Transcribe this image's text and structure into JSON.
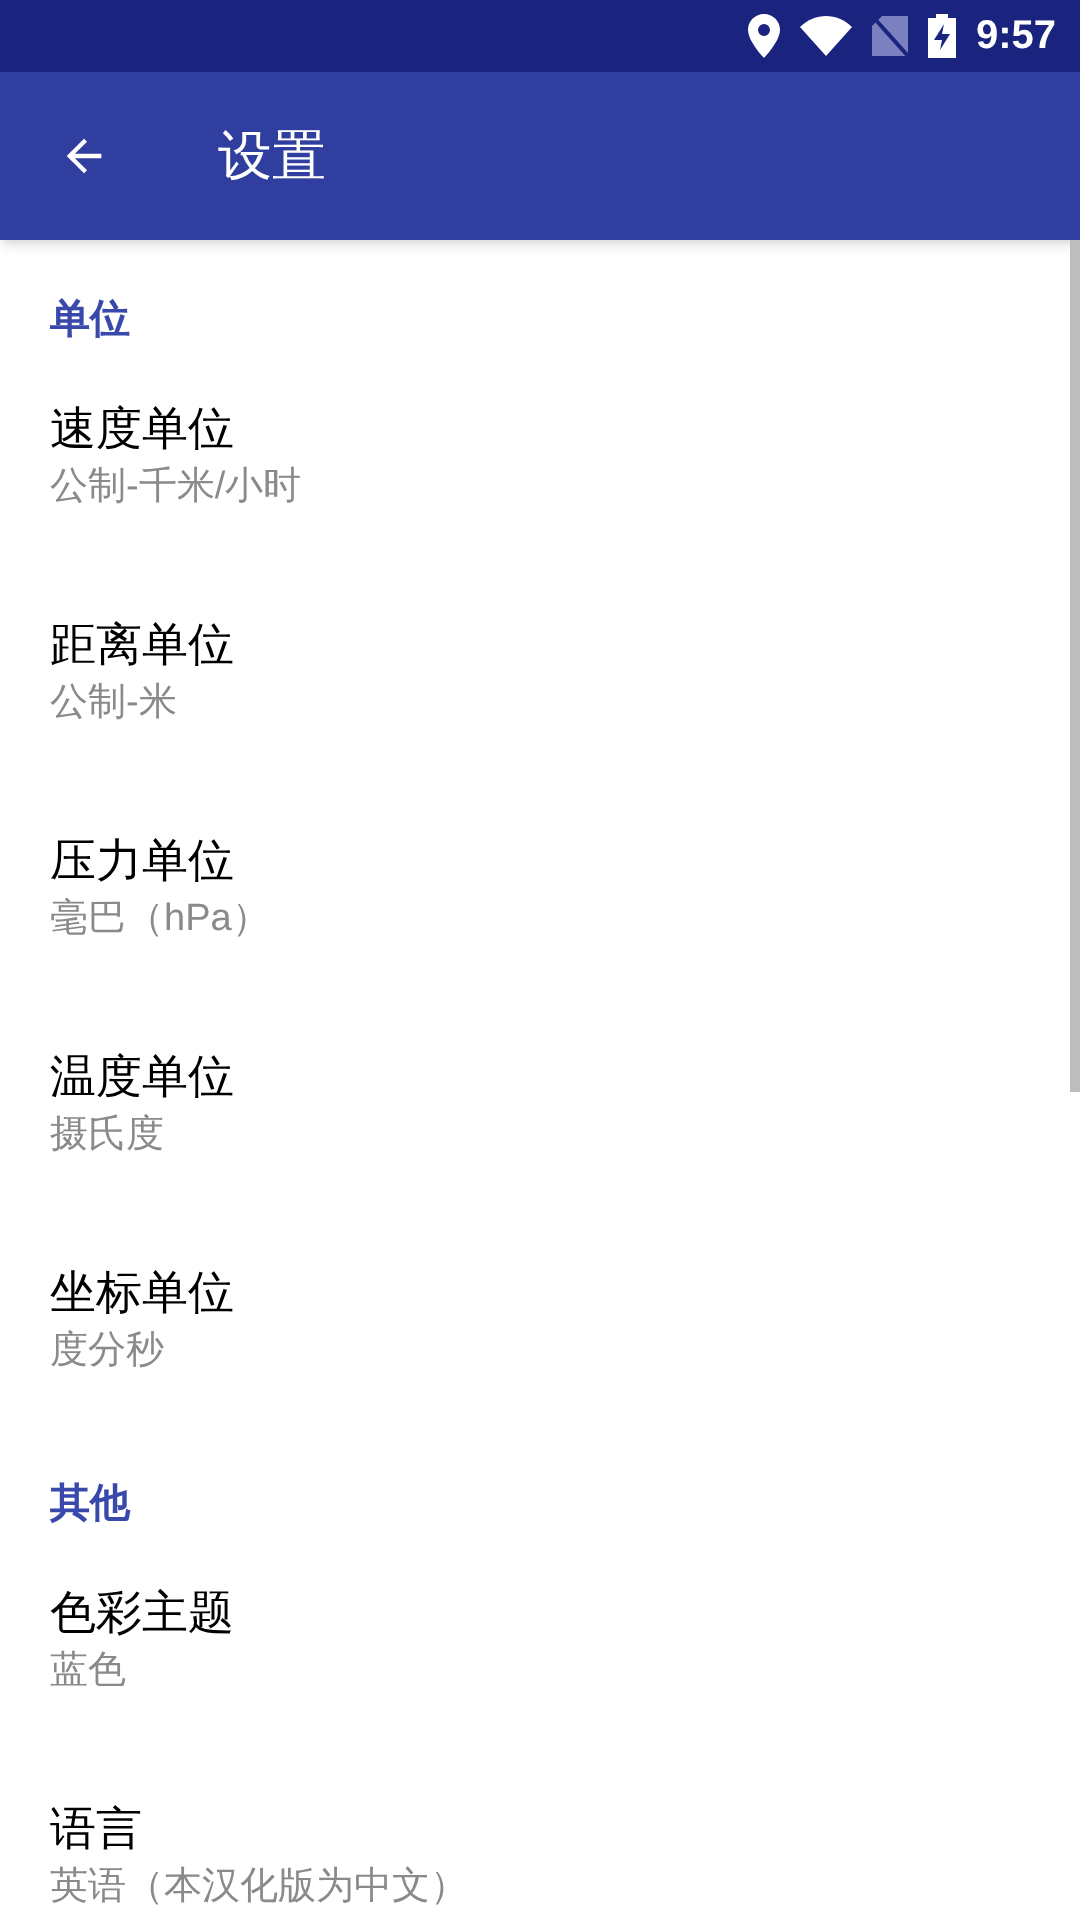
{
  "status_bar": {
    "time": "9:57"
  },
  "app_bar": {
    "title": "设置"
  },
  "sections": [
    {
      "header": "单位",
      "items": [
        {
          "title": "速度单位",
          "summary": "公制-千米/小时"
        },
        {
          "title": "距离单位",
          "summary": "公制-米"
        },
        {
          "title": "压力单位",
          "summary": "毫巴（hPa）"
        },
        {
          "title": "温度单位",
          "summary": "摄氏度"
        },
        {
          "title": "坐标单位",
          "summary": "度分秒"
        }
      ]
    },
    {
      "header": "其他",
      "items": [
        {
          "title": "色彩主题",
          "summary": "蓝色"
        },
        {
          "title": "语言",
          "summary": "英语（本汉化版为中文）"
        }
      ]
    }
  ]
}
